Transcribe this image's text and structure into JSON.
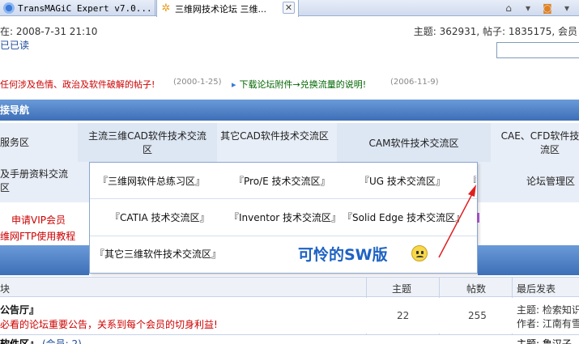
{
  "browser": {
    "tabs": [
      {
        "label": "TransMAGiC Expert v7.0..."
      },
      {
        "label": "三维网技术论坛 三维..."
      }
    ],
    "icons": [
      "home-icon",
      "dropdown-arrow-icon",
      "rss-icon",
      "chevron-down-icon"
    ]
  },
  "info": {
    "login_time": "在: 2008-7-31 21:10",
    "stats": "主题: 362931, 帖子: 1835175, 会员",
    "mark_read": "已已读"
  },
  "announcements": [
    {
      "text": "任何涉及色情、政治及软件破解的帖子!",
      "date": "(2000-1-25)"
    },
    {
      "text": "下载论坛附件→兑换流量的说明!",
      "date": "(2006-11-9)"
    }
  ],
  "section_header": "接导航",
  "nav": {
    "row1": [
      "服务区",
      "主流三维CAD软件技术交流区",
      "其它CAD软件技术交流区",
      "CAM软件技术交流区",
      "CAE、CFD软件技术交流区"
    ],
    "row2_left": "及手册资料交流区",
    "row2_right": "论坛管理区"
  },
  "popup": {
    "links": [
      "『三维网软件总练习区』",
      "『Pro/E 技术交流区』",
      "『UG 技术交流区』",
      "『",
      "『CATIA 技术交流区』",
      "『Inventor 技术交流区』",
      "『Solid Edge 技术交流区』",
      "『其它三维软件技术交流区』"
    ]
  },
  "annotation": "可怜的SW版",
  "left_links": {
    "vip": "申请VIP会员",
    "ftp": "维网FTP使用教程"
  },
  "table": {
    "headers": [
      "块",
      "主题",
      "帖数",
      "最后发表"
    ],
    "rows": [
      {
        "title": "公告厅』",
        "desc": "必看的论坛重要公告，关系到每个会员的切身利益!",
        "topics": "22",
        "posts": "255",
        "last_topic": "主题: 检索知识",
        "last_author": "作者: 江南有雪"
      },
      {
        "title": "软件区』",
        "desc": "(会员: 2)",
        "last_topic": "主题: 鲁汉子"
      }
    ]
  },
  "colors": {
    "header_blue": "#3d6fb8",
    "nav_bg": "#e8eef7",
    "annotation_blue": "#1e62c4",
    "arrow_red": "#e02020",
    "warning_red": "#cc0000"
  }
}
